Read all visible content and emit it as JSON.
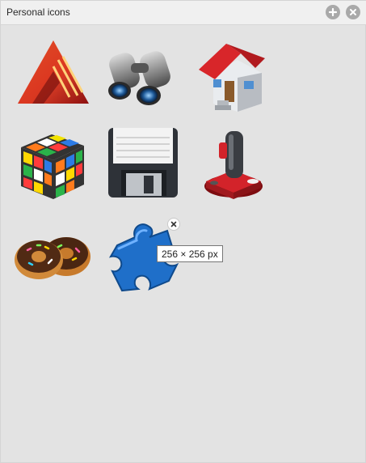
{
  "window": {
    "title": "Personal icons"
  },
  "toolbar": {
    "add_icon": "plus-icon",
    "close_icon": "close-icon"
  },
  "icons": [
    {
      "name": "affinity-publisher-app-icon"
    },
    {
      "name": "binoculars-icon"
    },
    {
      "name": "house-icon"
    },
    {
      "name": "rubiks-cube-icon"
    },
    {
      "name": "floppy-disk-icon"
    },
    {
      "name": "joystick-icon"
    },
    {
      "name": "donuts-icon"
    },
    {
      "name": "puzzle-piece-icon"
    }
  ],
  "tooltip": {
    "text": "256 × 256 px"
  },
  "colors": {
    "panel_bg": "#e3e3e3",
    "titlebar_bg": "#f0f0f0",
    "button_grey": "#a9a9a9",
    "puzzle_blue": "#1f6fc9"
  }
}
